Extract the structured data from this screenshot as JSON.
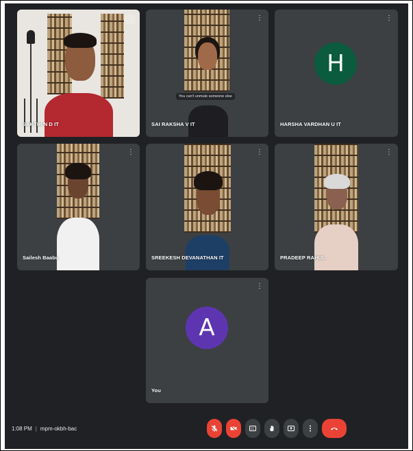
{
  "participants": [
    {
      "name": "SAKTHI N D IT"
    },
    {
      "name": "SAI RAKSHA V IT"
    },
    {
      "name": "HARSHA VARDHAN U IT",
      "avatar_letter": "H",
      "avatar_color": "#0b5b3e"
    },
    {
      "name": "Sailesh Baabu"
    },
    {
      "name": "SREEKESH DEVANATHAN IT"
    },
    {
      "name": "PRADEEP RAHUL"
    },
    {
      "name": "You",
      "avatar_letter": "A",
      "avatar_color": "#5e35b1"
    }
  ],
  "toast": "You can't unmute someone else",
  "meeting": {
    "time": "1:08 PM",
    "separator": "|",
    "code": "mpm-okbh-bac"
  },
  "controls": [
    {
      "name": "mic-off-icon",
      "style": "red"
    },
    {
      "name": "camera-off-icon",
      "style": "red"
    },
    {
      "name": "captions-icon",
      "style": "gray"
    },
    {
      "name": "raise-hand-icon",
      "style": "gray"
    },
    {
      "name": "present-icon",
      "style": "gray"
    },
    {
      "name": "more-options-icon",
      "style": "gray"
    },
    {
      "name": "end-call-icon",
      "style": "end"
    }
  ],
  "colors": {
    "background": "#202124",
    "tile": "#3c4043",
    "danger": "#ea4335"
  }
}
